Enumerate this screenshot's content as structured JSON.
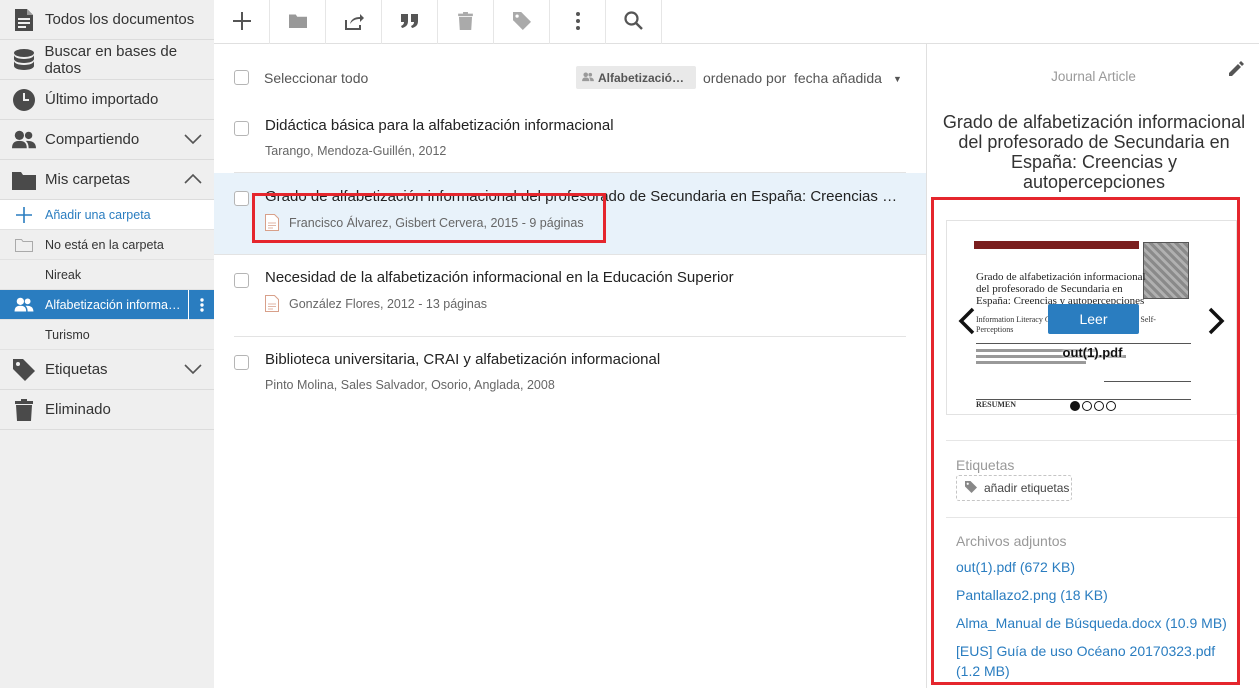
{
  "sidebar": {
    "items": [
      {
        "label": "Todos los documentos"
      },
      {
        "label": "Buscar en bases de datos"
      },
      {
        "label": "Último importado"
      },
      {
        "label": "Compartiendo"
      },
      {
        "label": "Mis carpetas"
      },
      {
        "label": "Etiquetas"
      },
      {
        "label": "Eliminado"
      }
    ],
    "folders": {
      "add": "Añadir una carpeta",
      "unfiled": "No está en la carpeta",
      "list": [
        "Nireak",
        "Alfabetización informaci…",
        "Turismo"
      ]
    }
  },
  "list": {
    "select_all": "Seleccionar todo",
    "folder_pill": "Alfabetizació…",
    "sort_label": "ordenado por",
    "sort_value": "fecha añadida",
    "documents": [
      {
        "title": "Didáctica básica para la alfabetización informacional",
        "meta": "Tarango, Mendoza-Guillén, 2012"
      },
      {
        "title": "Grado de alfabetización informacional del profesorado de Secundaria en España: Creencias y autopercepciones",
        "meta": "Francisco Álvarez, Gisbert Cervera, 2015 - 9 páginas"
      },
      {
        "title": "Necesidad de la alfabetización informacional en la Educación Superior",
        "meta": "González Flores, 2012 - 13 páginas"
      },
      {
        "title": "Biblioteca universitaria, CRAI y alfabetización informacional",
        "meta": "Pinto Molina, Sales Salvador, Osorio, Anglada, 2008"
      }
    ]
  },
  "panel": {
    "type": "Journal Article",
    "title": "Grado de alfabetización informacional del profesorado de Secundaria en España: Creencias y autopercepciones",
    "viewer": {
      "read_button": "Leer",
      "filename": "out(1).pdf",
      "paper_title": "Grado de alfabetización informacional del profesorado de Secundaria en España: Creencias y autopercepciones",
      "paper_sub": "Information Literacy Grade … pain — Beliefs and Self-Perceptions",
      "paper_resumen": "RESUMEN"
    },
    "tags_label": "Etiquetas",
    "add_tags": "añadir etiquetas",
    "attachments_label": "Archivos adjuntos",
    "attachments": [
      "out(1).pdf (672 KB)",
      "Pantallazo2.png (18 KB)",
      "Alma_Manual de Búsqueda.docx (10.9 MB)",
      "[EUS] Guía de uso Océano 20170323.pdf (1.2 MB)"
    ]
  },
  "colors": {
    "accent": "#2a7dc0",
    "highlight": "#e5262d",
    "selected_row": "#e8f2fa"
  }
}
